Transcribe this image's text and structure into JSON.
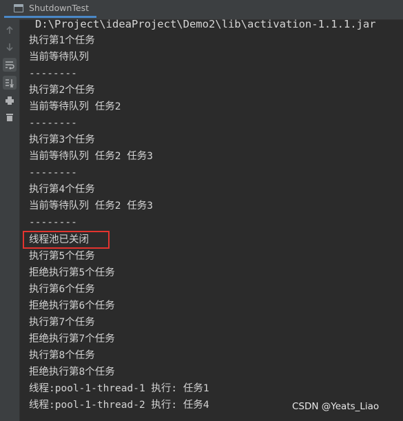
{
  "tab": {
    "label": "ShutdownTest"
  },
  "gutter": {
    "icons": [
      "arrow-up-icon",
      "arrow-down-icon",
      "soft-wrap-icon",
      "scroll-to-end-icon",
      "print-icon",
      "trash-icon"
    ]
  },
  "console": {
    "lines": [
      "D:\\Project\\ideaProject\\Demo2\\lib\\activation-1.1.1.jar",
      "执行第1个任务",
      "当前等待队列",
      "--------",
      "执行第2个任务",
      "当前等待队列 任务2",
      "--------",
      "执行第3个任务",
      "当前等待队列 任务2 任务3",
      "--------",
      "执行第4个任务",
      "当前等待队列 任务2 任务3",
      "--------",
      "线程池已关闭",
      "执行第5个任务",
      "拒绝执行第5个任务",
      "执行第6个任务",
      "拒绝执行第6个任务",
      "执行第7个任务",
      "拒绝执行第7个任务",
      "执行第8个任务",
      "拒绝执行第8个任务",
      "线程:pool-1-thread-1 执行: 任务1",
      "线程:pool-1-thread-2 执行: 任务4"
    ]
  },
  "watermark": "CSDN @Yeats_Liao",
  "colors": {
    "background": "#2b2b2b",
    "text": "#d4d4d4",
    "highlight_border": "#e3342f",
    "tab_underline": "#4a88c7"
  }
}
